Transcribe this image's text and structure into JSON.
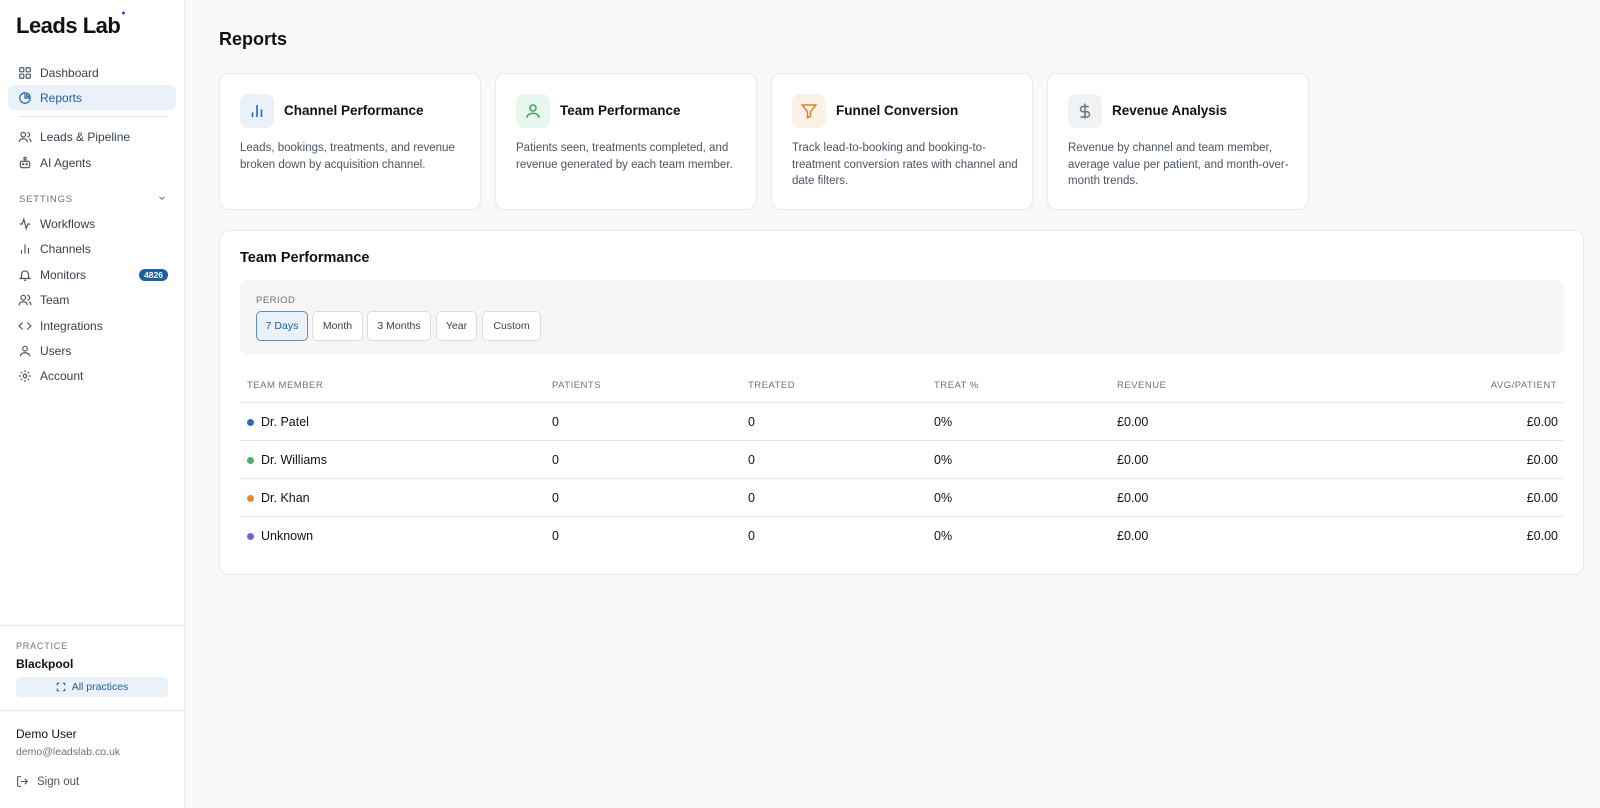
{
  "brand": {
    "logo_text": "Leads Lab"
  },
  "sidebar": {
    "nav": [
      {
        "label": "Dashboard",
        "icon": "grid-icon"
      },
      {
        "label": "Reports",
        "icon": "pie-chart-icon",
        "active": true
      },
      {
        "label": "Leads & Pipeline",
        "icon": "users-icon"
      },
      {
        "label": "AI Agents",
        "icon": "robot-icon"
      }
    ],
    "settings_label": "SETTINGS",
    "settings": [
      {
        "label": "Workflows",
        "icon": "activity-icon"
      },
      {
        "label": "Channels",
        "icon": "bar-chart-icon"
      },
      {
        "label": "Monitors",
        "icon": "bell-icon",
        "badge": "4826"
      },
      {
        "label": "Team",
        "icon": "users-icon"
      },
      {
        "label": "Integrations",
        "icon": "code-icon"
      },
      {
        "label": "Users",
        "icon": "user-icon"
      },
      {
        "label": "Account",
        "icon": "gear-icon"
      }
    ],
    "practice": {
      "label": "PRACTICE",
      "name": "Blackpool",
      "all_practices_label": "All practices"
    },
    "user": {
      "name": "Demo User",
      "email": "demo@leadslab.co.uk",
      "signout_label": "Sign out"
    }
  },
  "page": {
    "title": "Reports"
  },
  "report_cards": [
    {
      "title": "Channel Performance",
      "description": "Leads, bookings, treatments, and revenue broken down by acquisition channel.",
      "icon": "bar-chart-icon",
      "accent": "#2b6cb0",
      "icon_bg": "#eaf1f8"
    },
    {
      "title": "Team Performance",
      "description": "Patients seen, treatments completed, and revenue generated by each team member.",
      "icon": "user-icon",
      "accent": "#3aa65b",
      "icon_bg": "#e9f6ee"
    },
    {
      "title": "Funnel Conversion",
      "description": "Track lead-to-booking and booking-to-treatment conversion rates with channel and date filters.",
      "icon": "filter-icon",
      "accent": "#d9822b",
      "icon_bg": "#fcf1e6"
    },
    {
      "title": "Revenue Analysis",
      "description": "Revenue by channel and team member, average value per patient, and month-over-month trends.",
      "icon": "dollar-icon",
      "accent": "#6b7280",
      "icon_bg": "#f1f2f4"
    }
  ],
  "team_performance": {
    "title": "Team Performance",
    "period_label": "PERIOD",
    "periods": [
      "7 Days",
      "Month",
      "3 Months",
      "Year",
      "Custom"
    ],
    "selected_period": "7 Days",
    "columns": [
      "TEAM MEMBER",
      "PATIENTS",
      "TREATED",
      "TREAT %",
      "REVENUE",
      "AVG/PATIENT"
    ],
    "rows": [
      {
        "member": "Dr. Patel",
        "color": "#2b6cb0",
        "patients": "0",
        "treated": "0",
        "treat_pct": "0%",
        "revenue": "£0.00",
        "avg_patient": "£0.00"
      },
      {
        "member": "Dr. Williams",
        "color": "#4caf6a",
        "patients": "0",
        "treated": "0",
        "treat_pct": "0%",
        "revenue": "£0.00",
        "avg_patient": "£0.00"
      },
      {
        "member": "Dr. Khan",
        "color": "#e08a3c",
        "patients": "0",
        "treated": "0",
        "treat_pct": "0%",
        "revenue": "£0.00",
        "avg_patient": "£0.00"
      },
      {
        "member": "Unknown",
        "color": "#6a63d4",
        "patients": "0",
        "treated": "0",
        "treat_pct": "0%",
        "revenue": "£0.00",
        "avg_patient": "£0.00"
      }
    ]
  }
}
